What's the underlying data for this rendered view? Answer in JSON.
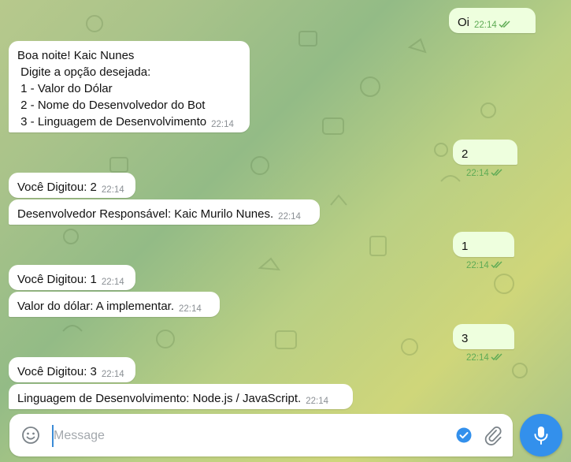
{
  "messages": [
    {
      "direction": "out",
      "text": "Oi",
      "time": "22:14",
      "status": "read"
    },
    {
      "direction": "in",
      "lines": [
        "Boa noite! Kaic Nunes",
        " Digite a opção desejada:",
        " 1 - Valor do Dólar",
        " 2 - Nome do Desenvolvedor do Bot",
        " 3 - Linguagem de Desenvolvimento"
      ],
      "time": "22:14"
    },
    {
      "direction": "out",
      "text": "2",
      "time": "22:14",
      "status": "read"
    },
    {
      "direction": "in",
      "text": "Você Digitou: 2",
      "time": "22:14"
    },
    {
      "direction": "in",
      "text": "Desenvolvedor Responsável: Kaic Murilo Nunes.",
      "time": "22:14"
    },
    {
      "direction": "out",
      "text": "1",
      "time": "22:14",
      "status": "read"
    },
    {
      "direction": "in",
      "text": "Você Digitou: 1",
      "time": "22:14"
    },
    {
      "direction": "in",
      "text": "Valor do dólar: A implementar.",
      "time": "22:14"
    },
    {
      "direction": "out",
      "text": "3",
      "time": "22:14",
      "status": "read"
    },
    {
      "direction": "in",
      "text": "Você Digitou: 3",
      "time": "22:14"
    },
    {
      "direction": "in",
      "text": "Linguagem de Desenvolvimento: Node.js / JavaScript.",
      "time": "22:14"
    }
  ],
  "composer": {
    "placeholder": "Message",
    "value": ""
  },
  "icons": {
    "emoji": "smile-icon",
    "check": "check-circle-icon",
    "attach": "paperclip-icon",
    "send": "microphone-icon",
    "read_status": "double-check-icon"
  },
  "colors": {
    "outgoing_bubble": "#eeffde",
    "incoming_bubble": "#ffffff",
    "accent": "#3390ec",
    "read_ticks": "#5fab55",
    "time_gray": "#8a8f94"
  }
}
